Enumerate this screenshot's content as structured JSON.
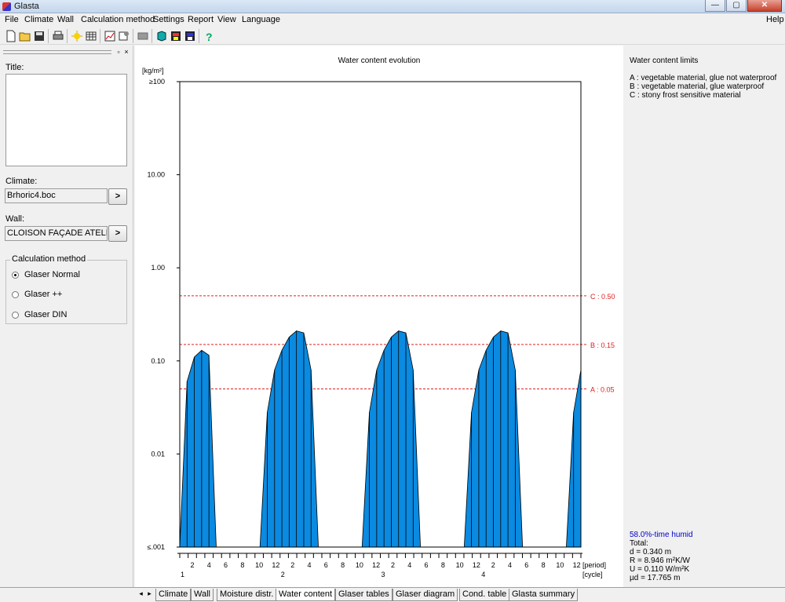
{
  "window": {
    "title": "Glasta",
    "buttons": [
      "—",
      "▢",
      "✕"
    ]
  },
  "menu": {
    "items": [
      "File",
      "Climate",
      "Wall",
      "Calculation method",
      "Settings",
      "Report",
      "View",
      "Language"
    ],
    "help": "Help"
  },
  "toolbar": {
    "icons": [
      "new-icon",
      "open-icon",
      "save-icon",
      "print-icon",
      "climate-icon",
      "table-icon",
      "chart-icon",
      "properties-icon",
      "grid-icon",
      "export-icon",
      "disk-icon",
      "disk-blue-icon",
      "help-icon"
    ]
  },
  "left": {
    "title_label": "Title:",
    "title_value": "",
    "climate_label": "Climate:",
    "climate_value": "Brhoric4.boc",
    "wall_label": "Wall:",
    "wall_value": "CLOISON FAÇADE ATELIE",
    "browse": ">",
    "method_label": "Calculation method",
    "methods": [
      {
        "label": "Glaser Normal",
        "selected": true
      },
      {
        "label": "Glaser ++",
        "selected": false
      },
      {
        "label": "Glaser DIN",
        "selected": false
      }
    ]
  },
  "chart_data": {
    "type": "area",
    "title": "Water content evolution",
    "ylabel": "[kg/m²]",
    "yscale": "log",
    "ylim": [
      0.001,
      100
    ],
    "yticks": [
      "≥100",
      "10.00",
      "1.00",
      "0.10",
      "0.01",
      "≤.001"
    ],
    "xlabel_period": "[period]",
    "xlabel_cycle": "[cycle]",
    "period_labels": [
      "2",
      "4",
      "6",
      "8",
      "10",
      "12",
      "2",
      "4",
      "6",
      "8",
      "10",
      "12",
      "2",
      "4",
      "6",
      "8",
      "10",
      "12",
      "2",
      "4",
      "6",
      "8",
      "10",
      "12"
    ],
    "cycle_labels": [
      "1",
      "2",
      "3",
      "4"
    ],
    "fill_color": "#0a8ae0",
    "limits": [
      {
        "label": "C : 0.50",
        "value": 0.5
      },
      {
        "label": "B : 0.15",
        "value": 0.15
      },
      {
        "label": "A : 0.05",
        "value": 0.05
      }
    ],
    "limit_color": "#e02020",
    "values": [
      0.001,
      0.06,
      0.11,
      0.13,
      0.115,
      0.001,
      null,
      null,
      null,
      null,
      null,
      0.001,
      0.028,
      0.08,
      0.13,
      0.18,
      0.21,
      0.2,
      0.08,
      0.001,
      null,
      null,
      null,
      null,
      null,
      0.001,
      0.028,
      0.08,
      0.13,
      0.18,
      0.21,
      0.2,
      0.08,
      0.001,
      null,
      null,
      null,
      null,
      null,
      0.001,
      0.028,
      0.08,
      0.13,
      0.18,
      0.21,
      0.2,
      0.08,
      0.001,
      null,
      null,
      null,
      null,
      null,
      0.001,
      0.028,
      0.08
    ],
    "grid": false
  },
  "right": {
    "title": "Water content limits",
    "limits": [
      "A : vegetable material, glue not waterproof",
      "B : vegetable material, glue waterproof",
      "C : stony frost sensitive material"
    ],
    "humid": "58.0%-time humid",
    "total_label": "Total:",
    "stats": [
      "d  = 0.340 m",
      "R  = 8.946 m²K/W",
      "U  = 0.110 W/m²K",
      "µd = 17.765 m"
    ]
  },
  "tabs": {
    "items": [
      "Climate",
      "Wall",
      "Moisture distr.",
      "Water content",
      "Glaser tables",
      "Glaser diagram",
      "Cond. table",
      "Glasta summary"
    ],
    "active": 3
  }
}
